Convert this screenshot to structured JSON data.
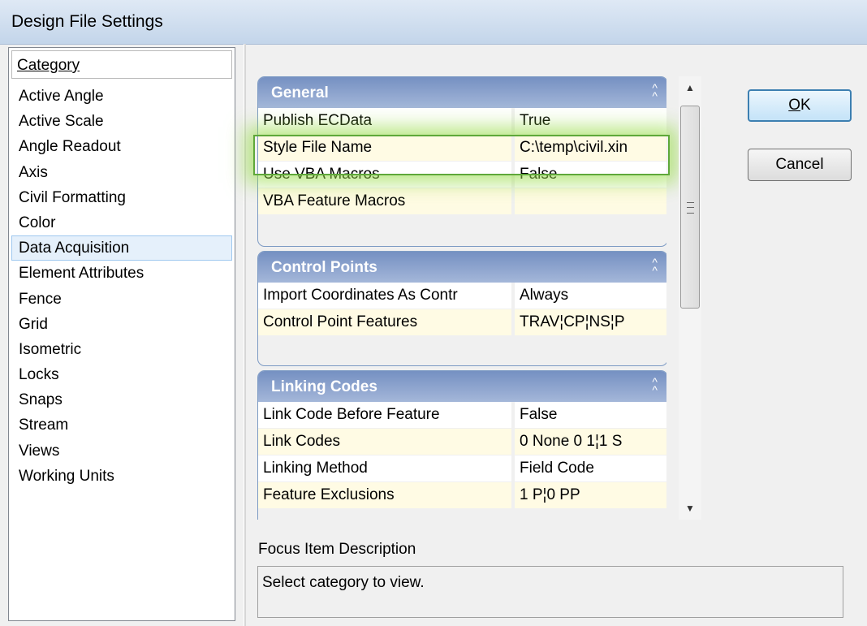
{
  "window": {
    "title": "Design File Settings"
  },
  "category": {
    "header": "Category",
    "items": [
      "Active Angle",
      "Active Scale",
      "Angle Readout",
      "Axis",
      "Civil Formatting",
      "Color",
      "Data Acquisition",
      "Element Attributes",
      "Fence",
      "Grid",
      "Isometric",
      "Locks",
      "Snaps",
      "Stream",
      "Views",
      "Working Units"
    ],
    "selected": "Data Acquisition"
  },
  "groups": {
    "general": {
      "title": "General",
      "rows": [
        {
          "key": "Publish ECData",
          "value": "True"
        },
        {
          "key": "Style File Name",
          "value": "C:\\temp\\civil.xin"
        },
        {
          "key": "Use VBA Macros",
          "value": "False"
        },
        {
          "key": "VBA Feature Macros",
          "value": ""
        }
      ]
    },
    "control_points": {
      "title": "Control Points",
      "rows": [
        {
          "key": "Import Coordinates As Contr",
          "value": "Always"
        },
        {
          "key": "Control Point Features",
          "value": "TRAV¦CP¦NS¦P"
        }
      ]
    },
    "linking_codes": {
      "title": "Linking Codes",
      "rows": [
        {
          "key": "Link Code Before Feature",
          "value": "False"
        },
        {
          "key": "Link Codes",
          "value": "0 None 0 1¦1 S"
        },
        {
          "key": "Linking Method",
          "value": "Field Code"
        },
        {
          "key": "Feature  Exclusions",
          "value": "1 P¦0 PP"
        }
      ]
    }
  },
  "buttons": {
    "ok_prefix": "",
    "ok_accel": "O",
    "ok_suffix": "K",
    "cancel": "Cancel"
  },
  "focus": {
    "label": "Focus Item Description",
    "text": "Select category to view."
  },
  "icons": {
    "collapse": "collapse-chevron-icon",
    "scroll_up": "scroll-up-arrow-icon",
    "scroll_down": "scroll-down-arrow-icon"
  }
}
